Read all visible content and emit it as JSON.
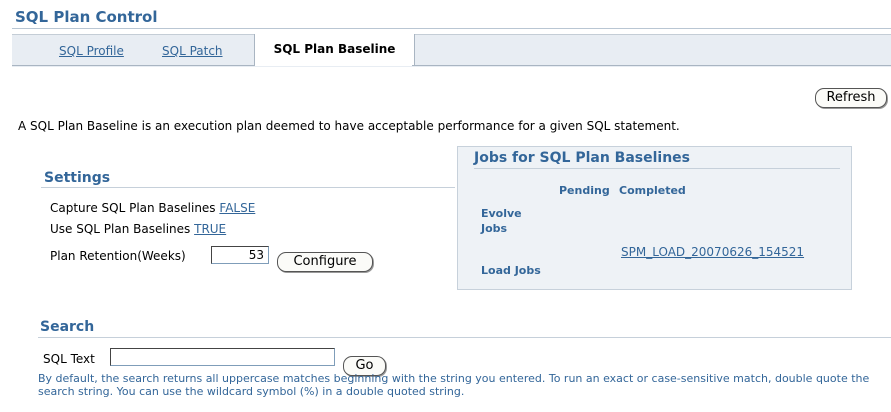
{
  "page": {
    "title": "SQL Plan Control"
  },
  "tabs": [
    {
      "label": "SQL Profile",
      "active": false
    },
    {
      "label": "SQL Patch",
      "active": false
    },
    {
      "label": "SQL Plan Baseline",
      "active": true
    }
  ],
  "toolbar": {
    "refresh_label": "Refresh"
  },
  "description": "A SQL Plan Baseline is an execution plan deemed to have acceptable performance for a given SQL statement.",
  "settings": {
    "header": "Settings",
    "capture_label": "Capture SQL Plan Baselines",
    "capture_value": "FALSE",
    "use_label": "Use SQL Plan Baselines",
    "use_value": "TRUE",
    "retention_label": "Plan Retention(Weeks)",
    "retention_value": "53",
    "configure_label": "Configure"
  },
  "jobs": {
    "header": "Jobs for SQL Plan Baselines",
    "col_pending": "Pending",
    "col_completed": "Completed",
    "evolve_label_1": "Evolve",
    "evolve_label_2": "Jobs",
    "load_label": "Load Jobs",
    "load_completed_link": "SPM_LOAD_20070626_154521"
  },
  "search": {
    "header": "Search",
    "sql_text_label": "SQL Text",
    "sql_text_value": "",
    "go_label": "Go",
    "help_text": "By default, the search returns all uppercase matches beginning with the string you entered. To run an exact or case-sensitive match, double quote the search string. You can use the wildcard symbol (%) in a double quoted string."
  },
  "colors": {
    "accent": "#336699",
    "tab_bg": "#e8edf3",
    "jobs_bg": "#eef2f6"
  }
}
